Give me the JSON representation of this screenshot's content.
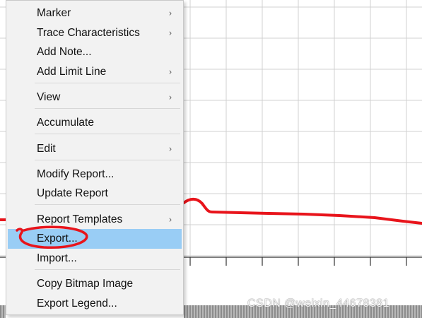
{
  "menu": {
    "items": [
      {
        "label": "Marker",
        "submenu": true
      },
      {
        "label": "Trace Characteristics",
        "submenu": true
      },
      {
        "label": "Add Note...",
        "submenu": false
      },
      {
        "label": "Add Limit Line",
        "submenu": true
      },
      {
        "label": "View",
        "submenu": true
      },
      {
        "label": "Accumulate",
        "submenu": false
      },
      {
        "label": "Edit",
        "submenu": true
      },
      {
        "label": "Modify Report...",
        "submenu": false
      },
      {
        "label": "Update Report",
        "submenu": false
      },
      {
        "label": "Report Templates",
        "submenu": true
      },
      {
        "label": "Export...",
        "submenu": false,
        "highlighted": true
      },
      {
        "label": "Import...",
        "submenu": false
      },
      {
        "label": "Copy Bitmap Image",
        "submenu": false
      },
      {
        "label": "Export Legend...",
        "submenu": false
      }
    ],
    "submenu_glyph": "›"
  },
  "watermark": "CSDN @weixin_44678381",
  "colors": {
    "trace": "#e8141b",
    "annotation_circle": "#e8141b",
    "menu_background": "#f2f2f2",
    "highlight": "#99cdf5",
    "grid": "#d0d0d0"
  }
}
